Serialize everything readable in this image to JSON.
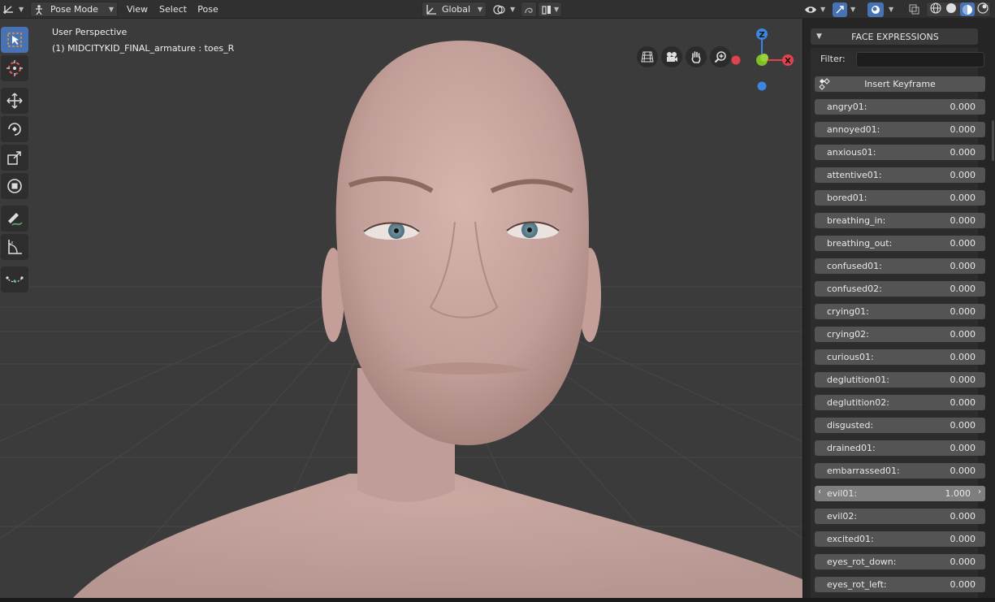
{
  "header": {
    "mode_label": "Pose Mode",
    "menus": [
      "View",
      "Select",
      "Pose"
    ],
    "transform_orientation": "Global"
  },
  "viewport": {
    "perspective_label": "User Perspective",
    "object_info": "(1) MIDCITYKID_FINAL_armature : toes_R",
    "gizmo_axes": [
      "Z",
      "X"
    ],
    "axis_colors": {
      "x": "#e0434d",
      "y": "#7fbf2a",
      "z": "#3d86e0"
    }
  },
  "toolbar": {
    "tools": [
      "select-box",
      "cursor",
      "move",
      "rotate",
      "scale",
      "transform",
      "annotate",
      "measure",
      "pose-breakdowner"
    ]
  },
  "sidebar": {
    "panel_title": "FACE EXPRESSIONS",
    "filter_label": "Filter:",
    "filter_value": "",
    "insert_keyframe_label": "Insert Keyframe",
    "shape_keys": [
      {
        "name": "angry01:",
        "value": "0.000"
      },
      {
        "name": "annoyed01:",
        "value": "0.000"
      },
      {
        "name": "anxious01:",
        "value": "0.000"
      },
      {
        "name": "attentive01:",
        "value": "0.000"
      },
      {
        "name": "bored01:",
        "value": "0.000"
      },
      {
        "name": "breathing_in:",
        "value": "0.000"
      },
      {
        "name": "breathing_out:",
        "value": "0.000"
      },
      {
        "name": "confused01:",
        "value": "0.000"
      },
      {
        "name": "confused02:",
        "value": "0.000"
      },
      {
        "name": "crying01:",
        "value": "0.000"
      },
      {
        "name": "crying02:",
        "value": "0.000"
      },
      {
        "name": "curious01:",
        "value": "0.000"
      },
      {
        "name": "deglutition01:",
        "value": "0.000"
      },
      {
        "name": "deglutition02:",
        "value": "0.000"
      },
      {
        "name": "disgusted:",
        "value": "0.000"
      },
      {
        "name": "drained01:",
        "value": "0.000"
      },
      {
        "name": "embarrassed01:",
        "value": "0.000"
      },
      {
        "name": "evil01:",
        "value": "1.000"
      },
      {
        "name": "evil02:",
        "value": "0.000"
      },
      {
        "name": "excited01:",
        "value": "0.000"
      },
      {
        "name": "eyes_rot_down:",
        "value": "0.000"
      },
      {
        "name": "eyes_rot_left:",
        "value": "0.000"
      }
    ]
  }
}
